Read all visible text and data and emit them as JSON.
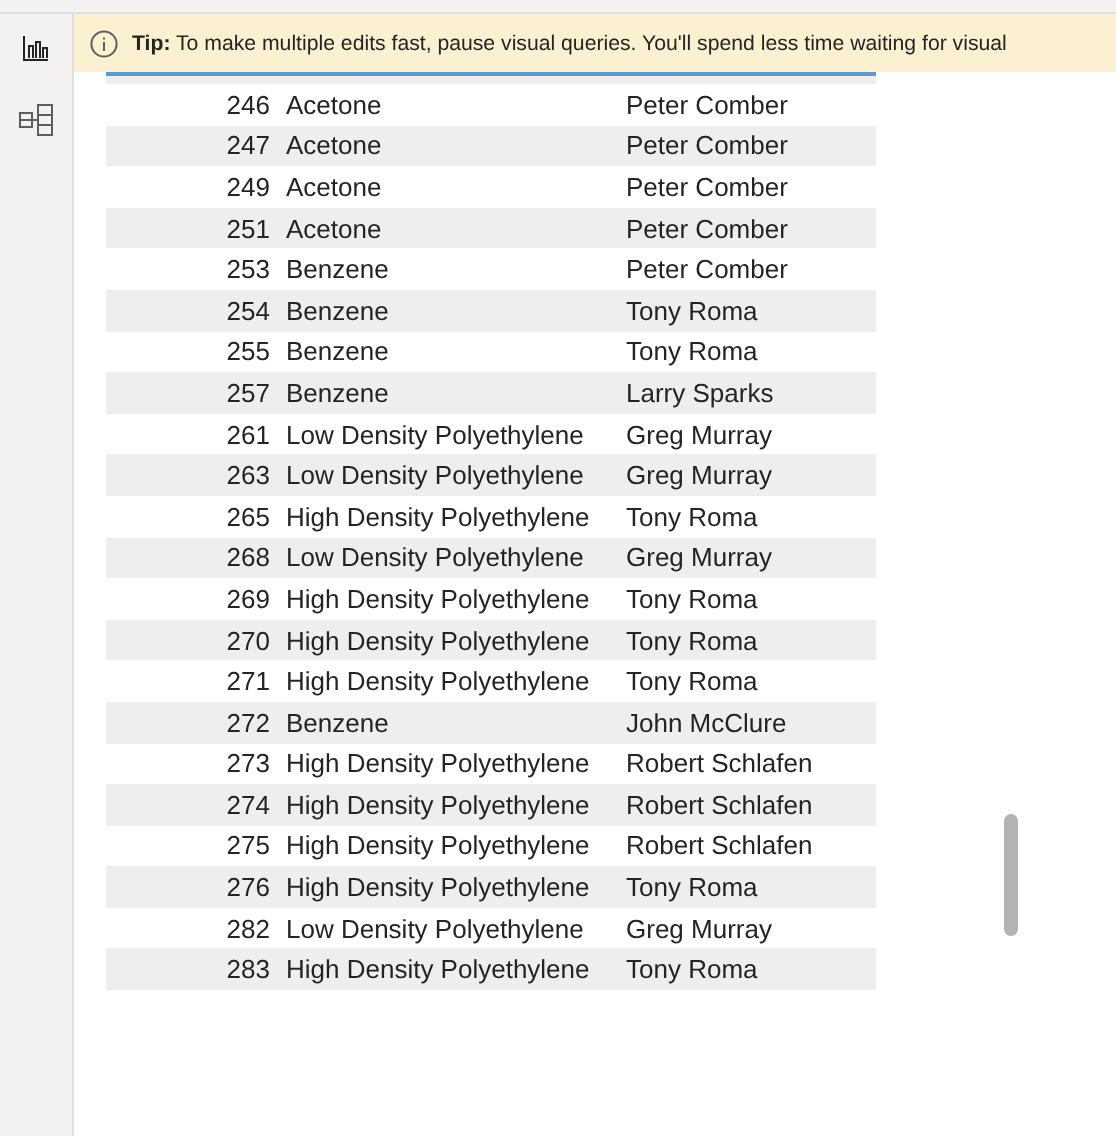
{
  "tip": {
    "label": "Tip:",
    "text": "To make multiple edits fast, pause visual queries. You'll spend less time waiting for visual"
  },
  "table": {
    "rows": [
      {
        "column_1": "246",
        "column_2": "Acetone",
        "column_3": "Peter Comber"
      },
      {
        "column_1": "247",
        "column_2": "Acetone",
        "column_3": "Peter Comber"
      },
      {
        "column_1": "249",
        "column_2": "Acetone",
        "column_3": "Peter Comber"
      },
      {
        "column_1": "251",
        "column_2": "Acetone",
        "column_3": "Peter Comber"
      },
      {
        "column_1": "253",
        "column_2": "Benzene",
        "column_3": "Peter Comber"
      },
      {
        "column_1": "254",
        "column_2": "Benzene",
        "column_3": "Tony Roma"
      },
      {
        "column_1": "255",
        "column_2": "Benzene",
        "column_3": "Tony Roma"
      },
      {
        "column_1": "257",
        "column_2": "Benzene",
        "column_3": "Larry Sparks"
      },
      {
        "column_1": "261",
        "column_2": "Low Density Polyethylene",
        "column_3": "Greg Murray"
      },
      {
        "column_1": "263",
        "column_2": "Low Density Polyethylene",
        "column_3": "Greg Murray"
      },
      {
        "column_1": "265",
        "column_2": "High Density Polyethylene",
        "column_3": "Tony Roma"
      },
      {
        "column_1": "268",
        "column_2": "Low Density Polyethylene",
        "column_3": "Greg Murray"
      },
      {
        "column_1": "269",
        "column_2": "High Density Polyethylene",
        "column_3": "Tony Roma"
      },
      {
        "column_1": "270",
        "column_2": "High Density Polyethylene",
        "column_3": "Tony Roma"
      },
      {
        "column_1": "271",
        "column_2": "High Density Polyethylene",
        "column_3": "Tony Roma"
      },
      {
        "column_1": "272",
        "column_2": "Benzene",
        "column_3": "John McClure"
      },
      {
        "column_1": "273",
        "column_2": "High Density Polyethylene",
        "column_3": "Robert Schlafen"
      },
      {
        "column_1": "274",
        "column_2": "High Density Polyethylene",
        "column_3": "Robert Schlafen"
      },
      {
        "column_1": "275",
        "column_2": "High Density Polyethylene",
        "column_3": "Robert Schlafen"
      },
      {
        "column_1": "276",
        "column_2": "High Density Polyethylene",
        "column_3": "Tony Roma"
      },
      {
        "column_1": "282",
        "column_2": "Low Density Polyethylene",
        "column_3": "Greg Murray"
      },
      {
        "column_1": "283",
        "column_2": "High Density Polyethylene",
        "column_3": "Tony Roma"
      }
    ]
  }
}
